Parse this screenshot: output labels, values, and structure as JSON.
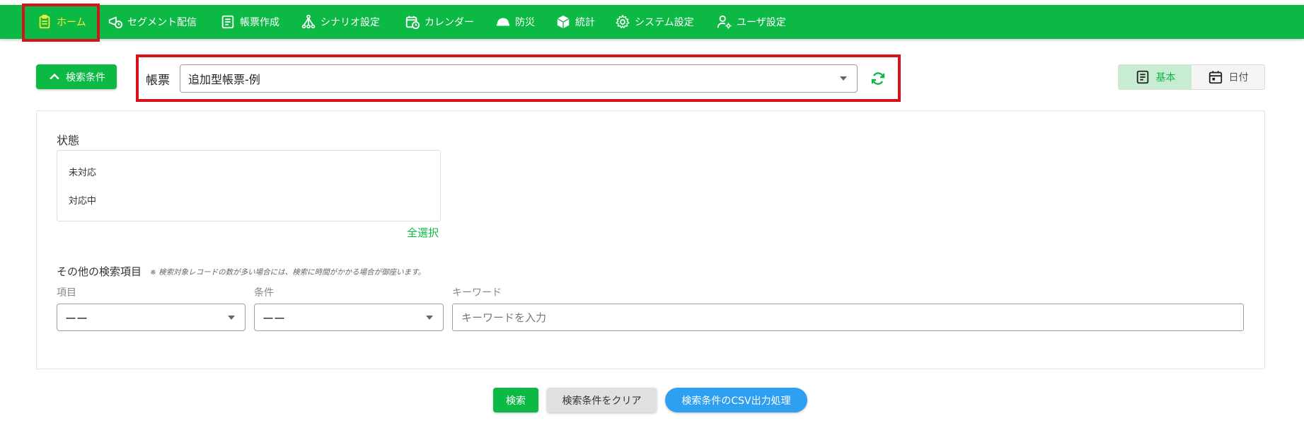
{
  "nav": {
    "items": [
      {
        "label": "ホーム",
        "icon": "clipboard-icon",
        "active": true
      },
      {
        "label": "セグメント配信",
        "icon": "megaphone-clock-icon"
      },
      {
        "label": "帳票作成",
        "icon": "document-icon"
      },
      {
        "label": "シナリオ設定",
        "icon": "sitemap-icon"
      },
      {
        "label": "カレンダー",
        "icon": "calendar-clock-icon"
      },
      {
        "label": "防災",
        "icon": "helmet-icon"
      },
      {
        "label": "統計",
        "icon": "cube-icon"
      },
      {
        "label": "システム設定",
        "icon": "gear-icon"
      },
      {
        "label": "ユーザ設定",
        "icon": "user-gear-icon"
      }
    ]
  },
  "search_toggle": {
    "label": "検索条件"
  },
  "form_selector": {
    "label": "帳票",
    "value": "追加型帳票-例"
  },
  "view_toggle": {
    "basic": "基本",
    "date": "日付"
  },
  "status": {
    "label": "状態",
    "options": [
      "未対応",
      "対応中"
    ],
    "select_all": "全選択"
  },
  "other_search": {
    "title": "その他の検索項目",
    "note": "※ 検索対象レコードの数が多い場合には、検索に時間がかかる場合が御座います。",
    "item_label": "項目",
    "item_value": "ーー",
    "condition_label": "条件",
    "condition_value": "ーー",
    "keyword_label": "キーワード",
    "keyword_placeholder": "キーワードを入力"
  },
  "actions": {
    "search": "検索",
    "clear": "検索条件をクリア",
    "csv": "検索条件のCSV出力処理"
  },
  "colors": {
    "brand_green": "#0db945",
    "highlight_red": "#d9111b",
    "active_nav": "#f4ef3a",
    "csv_blue": "#2f9ff2"
  }
}
